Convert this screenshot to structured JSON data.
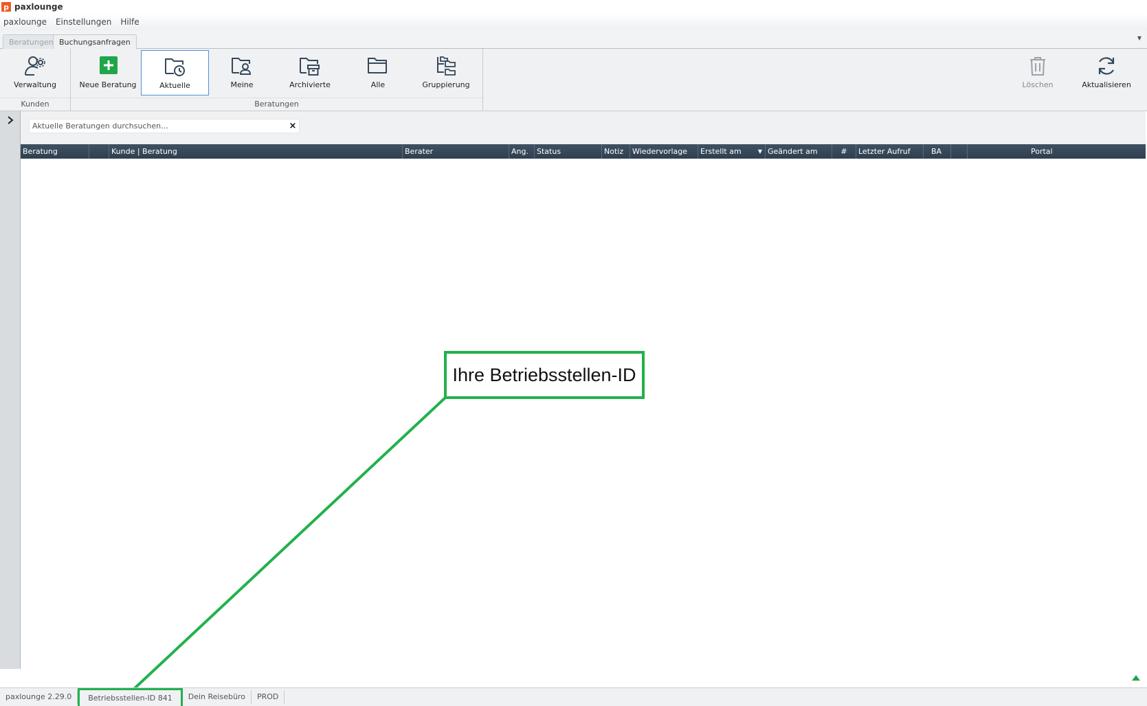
{
  "window": {
    "title": "paxlounge",
    "logo_letter": "p"
  },
  "menu": {
    "items": [
      "paxlounge",
      "Einstellungen",
      "Hilfe"
    ]
  },
  "tabs": [
    {
      "label": "Beratungen",
      "active": true
    },
    {
      "label": "Buchungsanfragen",
      "active": false
    }
  ],
  "ribbon": {
    "groups": {
      "kunden": "Kunden",
      "beratungen": "Beratungen"
    },
    "buttons": {
      "verwaltung": "Verwaltung",
      "neue_beratung": "Neue Beratung",
      "aktuelle": "Aktuelle",
      "meine": "Meine",
      "archivierte": "Archivierte",
      "alle": "Alle",
      "gruppierung": "Gruppierung",
      "loeschen": "Löschen",
      "aktualisieren": "Aktualisieren"
    },
    "selected": "Aktuelle"
  },
  "search": {
    "placeholder": "Aktuelle Beratungen durchsuchen…",
    "clear_symbol": "×"
  },
  "grid": {
    "columns": [
      "Beratung",
      "",
      "Kunde | Beratung",
      "Berater",
      "Ang.",
      "Status",
      "Notiz",
      "Wiedervorlage",
      "Erstellt am",
      "Geändert am",
      "#",
      "Letzter Aufruf",
      "BA",
      "",
      "Portal"
    ],
    "sorted_column": "Erstellt am",
    "rows": []
  },
  "annotation": {
    "text": "Ihre Betriebsstellen-ID"
  },
  "status": {
    "version": "paxlounge 2.29.0",
    "betriebsstelle": "Betriebsstellen-ID 841",
    "office": "Dein Reisebüro",
    "env": "PROD"
  },
  "colors": {
    "highlight": "#22b14c",
    "header": "#34475a",
    "add": "#1fa64a",
    "logo": "#ee5a24"
  }
}
